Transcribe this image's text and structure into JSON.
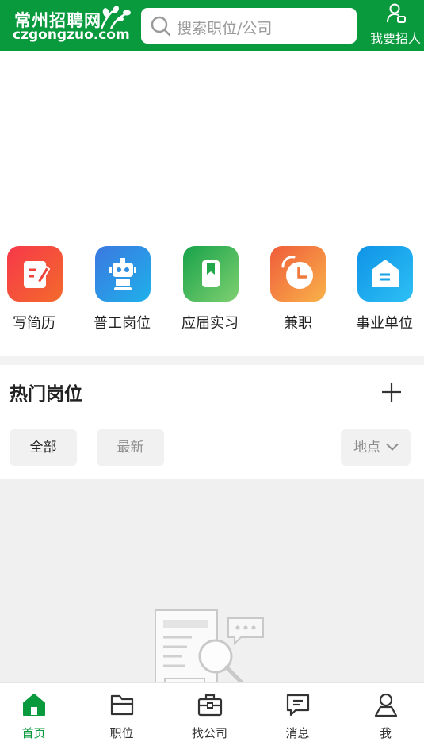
{
  "header": {
    "logo_cn": "常州招聘网",
    "logo_en": "czgongzuo.com",
    "search_placeholder": "搜索职位/公司",
    "recruit_label": "我要招人"
  },
  "categories": [
    {
      "label": "写简历",
      "icon": "resume-pen-icon",
      "color": "#f0443a"
    },
    {
      "label": "普工岗位",
      "icon": "robot-icon",
      "color": "#2f8fe0"
    },
    {
      "label": "应届实习",
      "icon": "bookmark-book-icon",
      "color": "#22a84b"
    },
    {
      "label": "兼职",
      "icon": "clock-icon",
      "color": "#f07a3e"
    },
    {
      "label": "事业单位",
      "icon": "building-icon",
      "color": "#17a2e8"
    }
  ],
  "hot_jobs": {
    "title": "热门岗位",
    "filters": {
      "all": "全部",
      "latest": "最新",
      "location": "地点"
    }
  },
  "tabbar": {
    "items": [
      {
        "label": "首页",
        "icon": "home-icon",
        "active": true
      },
      {
        "label": "职位",
        "icon": "folder-icon",
        "active": false
      },
      {
        "label": "找公司",
        "icon": "briefcase-icon",
        "active": false
      },
      {
        "label": "消息",
        "icon": "message-icon",
        "active": false
      },
      {
        "label": "我",
        "icon": "person-icon",
        "active": false
      }
    ]
  },
  "colors": {
    "brand_green": "#0a9a3e"
  }
}
